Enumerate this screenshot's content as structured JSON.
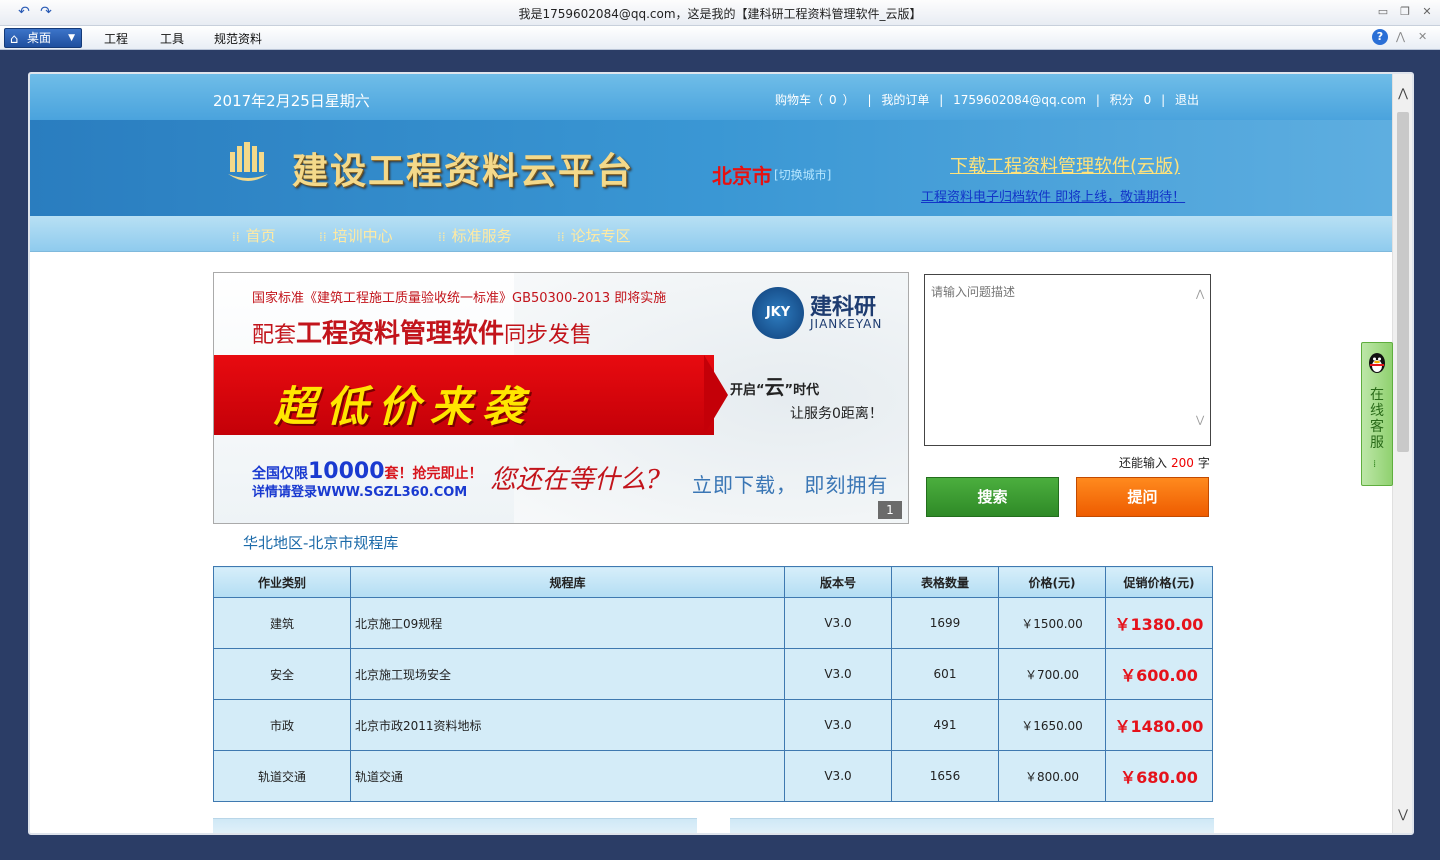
{
  "window": {
    "title": "我是1759602084@qq.com，这是我的【建科研工程资料管理软件_云版】"
  },
  "menubar": {
    "desktop": "桌面",
    "items": [
      "工程",
      "工具",
      "规范资料"
    ]
  },
  "topbar": {
    "date": "2017年2月25日星期六",
    "cart_label": "购物车（",
    "cart_count": "0",
    "cart_close": "）",
    "sep": "|",
    "orders": "我的订单",
    "email": "1759602084@qq.com",
    "points_label": "积分",
    "points": "0",
    "logout": "退出"
  },
  "banner": {
    "logo_text": "建设工程资料云平台",
    "city": "北京市",
    "city_switch": "[切换城市]",
    "download_link": "下载工程资料管理软件(云版)",
    "sub_link": "工程资料电子归档软件 即将上线，敬请期待！"
  },
  "nav": {
    "items": [
      "首页",
      "培训中心",
      "标准服务",
      "论坛专区"
    ]
  },
  "ad": {
    "line1": "国家标准《建筑工程施工质量验收统一标准》GB50300-2013 即将实施",
    "line2_pre": "配套",
    "line2_big": "工程资料管理软件",
    "line2_post": "同步发售",
    "ribbon": "超低价来袭",
    "jky": "JKY",
    "brand": "建科研",
    "brand_en": "JIANKEYAN",
    "open_pre": "开启“",
    "open_big": "云",
    "open_post": "”时代",
    "service": "让服务0距离！",
    "limit_pre": "全国仅限",
    "limit_num": "10000",
    "limit_post": "套！抢完即止！",
    "site": "详情请登录WWW.SGZL360.COM",
    "slogan": "您还在等什么?",
    "download": "立即下载， 即刻拥有",
    "page": "1"
  },
  "question": {
    "placeholder": "请输入问题描述",
    "remain_label": "还能输入",
    "remain_num": "200",
    "remain_unit": "字",
    "search": "搜索",
    "ask": "提问"
  },
  "region_title": "华北地区-北京市规程库",
  "table": {
    "headers": [
      "作业类别",
      "规程库",
      "版本号",
      "表格数量",
      "价格(元)",
      "促销价格(元)"
    ],
    "rows": [
      [
        "建筑",
        "北京施工09规程",
        "V3.0",
        "1699",
        "￥1500.00",
        "￥1380.00"
      ],
      [
        "安全",
        "北京施工现场安全",
        "V3.0",
        "601",
        "￥700.00",
        "￥600.00"
      ],
      [
        "市政",
        "北京市政2011资料地标",
        "V3.0",
        "491",
        "￥1650.00",
        "￥1480.00"
      ],
      [
        "轨道交通",
        "轨道交通",
        "V3.0",
        "1656",
        "￥800.00",
        "￥680.00"
      ]
    ]
  },
  "service": {
    "label": "在线客服"
  },
  "colors": {
    "accent": "#4aa3dd",
    "promo_red": "#e5121b",
    "search_green": "#2f8a27",
    "ask_orange": "#ee5c00"
  }
}
